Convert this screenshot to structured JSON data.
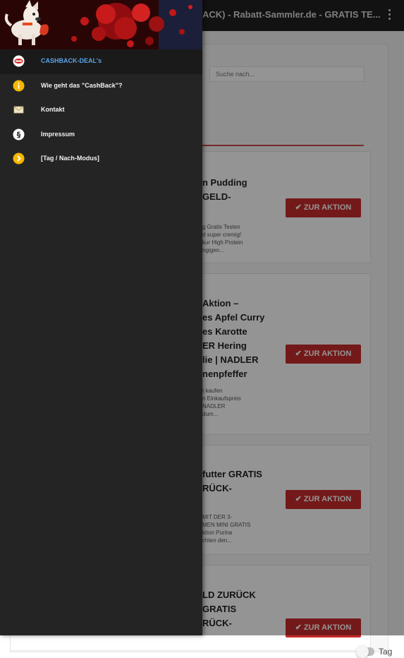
{
  "appbar": {
    "title": "ACK) - Rabatt-Sammler.de - GRATIS TE..."
  },
  "search": {
    "placeholder": "Suche nach..."
  },
  "cards": [
    {
      "date": "",
      "title_lines": [
        "n Pudding",
        "GELD-"
      ],
      "excerpt_lines": [
        "g Gratis Testen",
        "d super cremig!",
        "kur High Protein",
        "ngigen..."
      ],
      "cta": "✔ ZUR AKTION"
    },
    {
      "date": "",
      "title_lines": [
        "Aktion –",
        "es Apfel Curry",
        "es Karotte",
        "ER Hering",
        "lie | NADLER",
        "nenpfeffer"
      ],
      "excerpt_lines": [
        "t kaufen",
        "n Einkaufspreis",
        "NADLER",
        "dum..."
      ],
      "cta": "✔ ZUR AKTION"
    },
    {
      "date": "",
      "title_lines": [
        "futter GRATIS",
        "RÜCK-"
      ],
      "excerpt_lines": [
        "MIT DER 3-",
        "MEN MINI GRATIS",
        "ktion Purina",
        "chten den..."
      ],
      "cta": "✔ ZUR AKTION"
    },
    {
      "date": "",
      "title_lines": [
        "LD ZURÜCK",
        "GRATIS",
        "RÜCK-"
      ],
      "excerpt_lines": [],
      "cta": "✔ ZUR AKTION"
    }
  ],
  "toggle": {
    "label": "Tag",
    "on": false
  },
  "drawer": {
    "items": [
      {
        "label": "CASHBACK-DEAL's",
        "icon": "cashback-logo-icon",
        "active": true
      },
      {
        "label": "Wie geht das \"CashBack\"?",
        "icon": "info-icon",
        "active": false
      },
      {
        "label": "Kontakt",
        "icon": "mail-icon",
        "active": false
      },
      {
        "label": "Impressum",
        "icon": "paragraph-icon",
        "active": false
      },
      {
        "label": "[Tag / Nach-Modus]",
        "icon": "mode-switch-icon",
        "active": false
      }
    ]
  },
  "colors": {
    "accent": "#5ba3e6",
    "cta": "#c92b2b",
    "drawer_bg": "#242424",
    "icon_yellow": "#f5b800"
  }
}
